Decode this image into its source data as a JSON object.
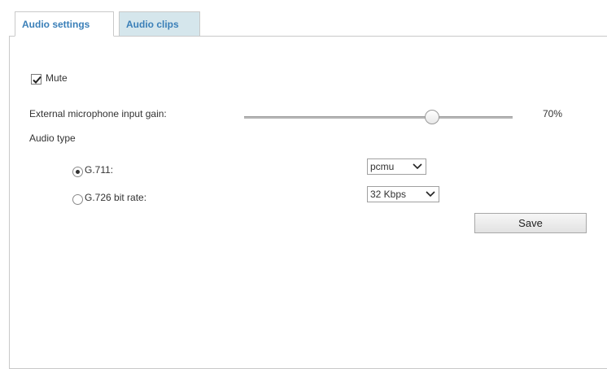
{
  "tabs": [
    {
      "label": "Audio settings",
      "active": true
    },
    {
      "label": "Audio clips",
      "active": false
    }
  ],
  "mute": {
    "label": "Mute",
    "checked": true
  },
  "gain": {
    "label": "External microphone input gain:",
    "value_text": "70%",
    "value": 0.7
  },
  "audio_type": {
    "label": "Audio type",
    "g711": {
      "label": "G.711:",
      "selected": true,
      "codec": "pcmu"
    },
    "g726": {
      "label": "G.726 bit rate:",
      "selected": false,
      "bitrate": "32 Kbps"
    }
  },
  "save_label": "Save",
  "icons": {
    "mute_check": "checkmark-icon",
    "select_arrow": "chevron-down-icon"
  }
}
